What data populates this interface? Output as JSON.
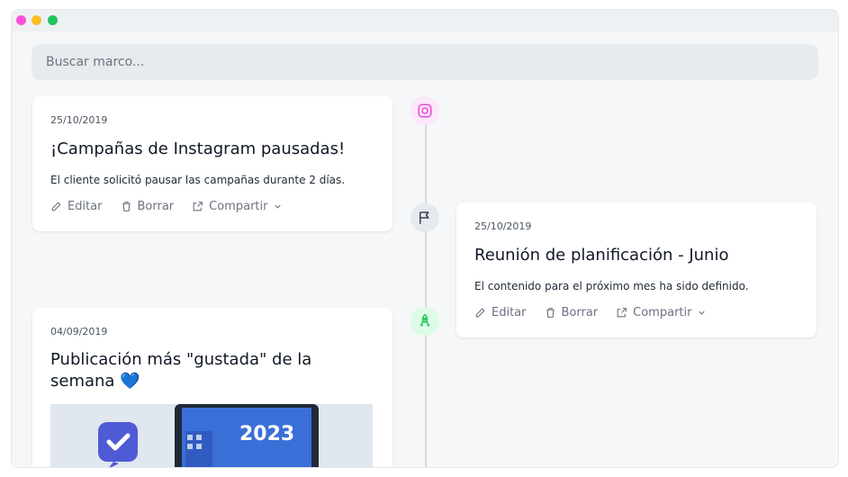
{
  "search": {
    "placeholder": "Buscar marco..."
  },
  "events": [
    {
      "date": "25/10/2019",
      "title": "¡Campañas de Instagram pausadas!",
      "description": "El cliente solicitó pausar las campañas durante 2 días.",
      "icon": "instagram-icon",
      "actions": {
        "edit": "Editar",
        "delete": "Borrar",
        "share": "Compartir"
      }
    },
    {
      "date": "25/10/2019",
      "title": "Reunión de planificación - Junio",
      "description": "El contenido para el próximo mes ha sido definido.",
      "icon": "flag-icon",
      "actions": {
        "edit": "Editar",
        "delete": "Borrar",
        "share": "Compartir"
      }
    },
    {
      "date": "04/09/2019",
      "title": "Publicación más \"gustada\" de la semana",
      "title_emoji": "💙",
      "image_text": "2023",
      "icon": "rocket-icon"
    }
  ],
  "colors": {
    "instagram_accent": "#e64ad6",
    "rocket_accent": "#22c55e",
    "flag_accent": "#374151"
  }
}
